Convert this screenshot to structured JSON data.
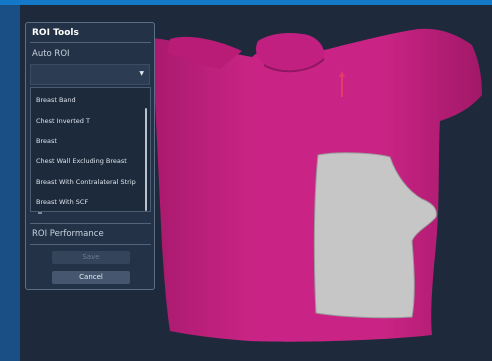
{
  "app": {
    "accent_color": "#1478c8",
    "background_color": "#1e2a3b"
  },
  "roi_tools": {
    "title": "ROI Tools",
    "auto_roi_label": "Auto ROI",
    "selected_value": "",
    "caret_icon": "caret-down-icon",
    "options": [
      "Breast Band",
      "Chest Inverted T",
      "Breast",
      "Chest Wall Excluding Breast",
      "Breast With Contralateral Strip",
      "Breast With SCF"
    ],
    "roi_performance_label": "ROI Performance",
    "save_label": "Save",
    "cancel_label": "Cancel"
  },
  "viewport": {
    "body_color": "#c4207f",
    "roi_color": "#c8c8c8",
    "marker_color": "#e33b6a"
  }
}
